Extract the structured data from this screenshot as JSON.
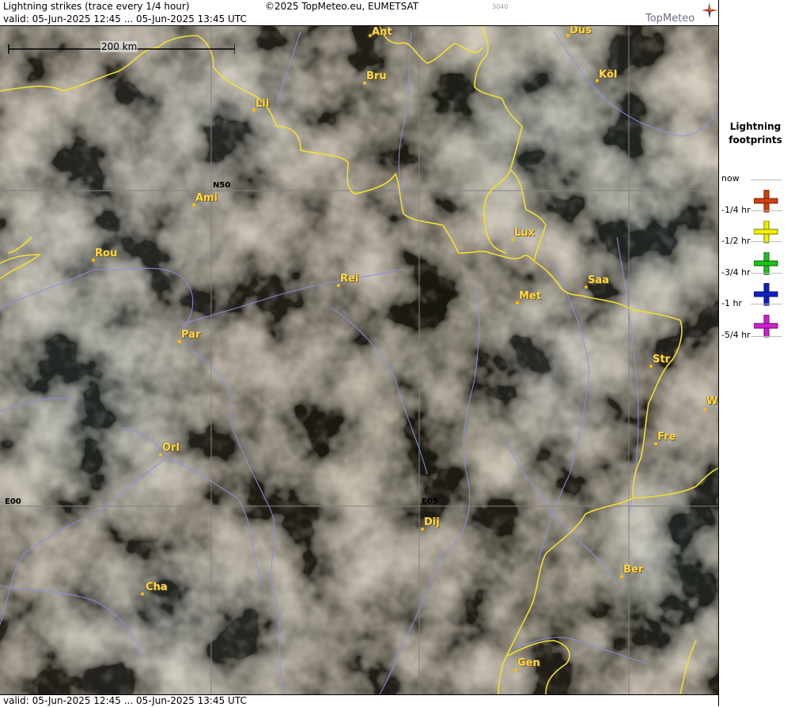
{
  "header": {
    "title": "Lightning strikes (trace every 1/4 hour)",
    "copyright": "©2025 TopMeteo.eu, EUMETSAT",
    "id_code": "3040",
    "valid": "valid:  05-Jun-2025 12:45 ... 05-Jun-2025 13:45 UTC",
    "logo": "TopMeteo"
  },
  "footer": {
    "valid": "valid:  05-Jun-2025 12:45 ... 05-Jun-2025 13:45 UTC"
  },
  "scale": {
    "label": "200 km"
  },
  "grid_labels": {
    "n50": "N50",
    "e00": "E00",
    "e05": "E05"
  },
  "cities": [
    {
      "name": "Ant"
    },
    {
      "name": "Düs"
    },
    {
      "name": "Bru"
    },
    {
      "name": "Köl"
    },
    {
      "name": "Lil"
    },
    {
      "name": "Ami"
    },
    {
      "name": "Lux"
    },
    {
      "name": "Rou"
    },
    {
      "name": "Rei"
    },
    {
      "name": "Saa"
    },
    {
      "name": "Met"
    },
    {
      "name": "Par"
    },
    {
      "name": "Str"
    },
    {
      "name": "W"
    },
    {
      "name": "Fre"
    },
    {
      "name": "Orl"
    },
    {
      "name": "Dij"
    },
    {
      "name": "Ber"
    },
    {
      "name": "Cha"
    },
    {
      "name": "Gen"
    }
  ],
  "legend": {
    "title_line1": "Lightning",
    "title_line2": "footprints",
    "rows": [
      {
        "label": "now",
        "color": ""
      },
      {
        "label": "-1/4 hr",
        "color": "#d04010"
      },
      {
        "label": "-1/2 hr",
        "color": "#f0f000"
      },
      {
        "label": "-3/4 hr",
        "color": "#20c020"
      },
      {
        "label": "-1 hr",
        "color": "#1020c0"
      },
      {
        "label": "-5/4 hr",
        "color": "#d020d0"
      }
    ]
  },
  "colors": {
    "border": "#f0e030",
    "river": "#8a90e0",
    "grid": "#808080"
  }
}
